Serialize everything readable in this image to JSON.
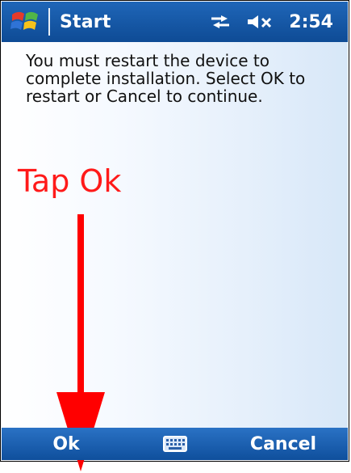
{
  "header": {
    "title": "Start",
    "time": "2:54",
    "icons": [
      "windows-start-icon",
      "connectivity-icon",
      "volume-mute-icon"
    ]
  },
  "dialog": {
    "message": "You must restart the device to complete installation. Select OK to restart or Cancel to continue."
  },
  "annotation": {
    "text": "Tap Ok",
    "color": "#ff1a1a"
  },
  "softkeys": {
    "left_label": "Ok",
    "right_label": "Cancel",
    "center_icon": "keyboard-icon"
  },
  "colors": {
    "bar_blue": "#0e4b95",
    "accent_red": "#ff1a1a"
  }
}
